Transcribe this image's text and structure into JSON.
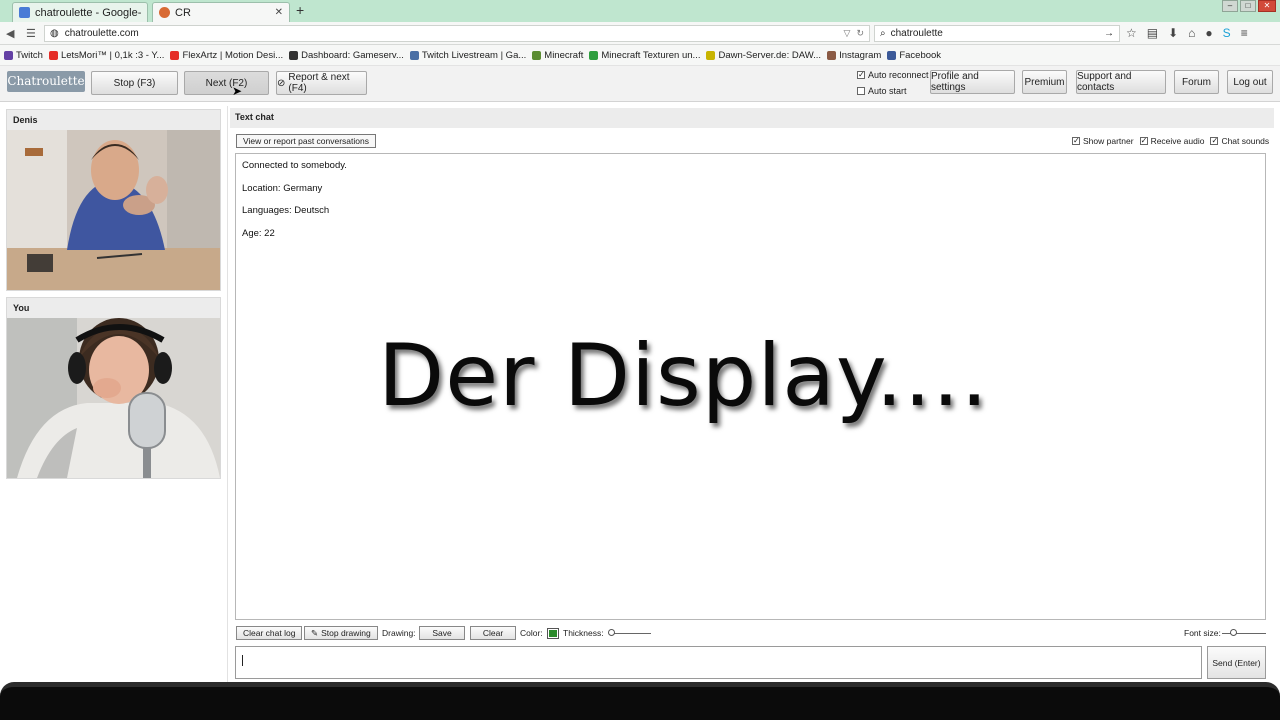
{
  "browser": {
    "tabs": [
      {
        "title": "chatroulette - Google-Suche",
        "icon": "google-g-icon"
      },
      {
        "title": "CR",
        "icon": "chatroulette-icon"
      }
    ],
    "new_tab_label": "+",
    "url": "chatroulette.com",
    "search_query": "chatroulette",
    "bookmarks": [
      {
        "label": "Twitch",
        "color": "#6441a5"
      },
      {
        "label": "LetsMori™ | 0,1k :3 - Y...",
        "color": "#e52d27"
      },
      {
        "label": "FlexArtz | Motion Desi...",
        "color": "#e52d27"
      },
      {
        "label": "Dashboard: Gameserv...",
        "color": "#333333"
      },
      {
        "label": "Twitch Livestream | Ga...",
        "color": "#4a6fa5"
      },
      {
        "label": "Minecraft",
        "color": "#5b8c32"
      },
      {
        "label": "Minecraft Texturen un...",
        "color": "#2e9e3e"
      },
      {
        "label": "Dawn-Server.de: DAW...",
        "color": "#c8b400"
      },
      {
        "label": "Instagram",
        "color": "#8a5a44"
      },
      {
        "label": "Facebook",
        "color": "#3b5998"
      }
    ]
  },
  "header": {
    "logo": "Chatroulette",
    "stop_label": "Stop (F3)",
    "next_label": "Next (F2)",
    "report_label": "Report & next (F4)",
    "auto_reconnect": {
      "label": "Auto reconnect",
      "checked": true
    },
    "auto_start": {
      "label": "Auto start",
      "checked": false
    },
    "profile_label": "Profile and settings",
    "premium_label": "Premium",
    "support_label": "Support and contacts",
    "forum_label": "Forum",
    "logout_label": "Log out"
  },
  "partner_panel": {
    "name": "Denis"
  },
  "self_panel": {
    "name": "You"
  },
  "chat": {
    "header": "Text chat",
    "past_button": "View or report past conversations",
    "show_partner": {
      "label": "Show partner",
      "checked": true
    },
    "receive_audio": {
      "label": "Receive audio",
      "checked": true
    },
    "chat_sounds": {
      "label": "Chat sounds",
      "checked": true
    },
    "lines": [
      "Connected to somebody.",
      "Location: Germany",
      "Languages: Deutsch",
      "Age: 22"
    ],
    "overlay_caption": "Der Display...."
  },
  "controls": {
    "clear_log": "Clear chat log",
    "stop_drawing": "Stop drawing",
    "drawing_label": "Drawing:",
    "save": "Save",
    "clear": "Clear",
    "color_label": "Color:",
    "color_value": "#2b8a2b",
    "thickness_label": "Thickness:",
    "font_size_label": "Font size:",
    "send_label": "Send (Enter)",
    "message_value": ""
  }
}
